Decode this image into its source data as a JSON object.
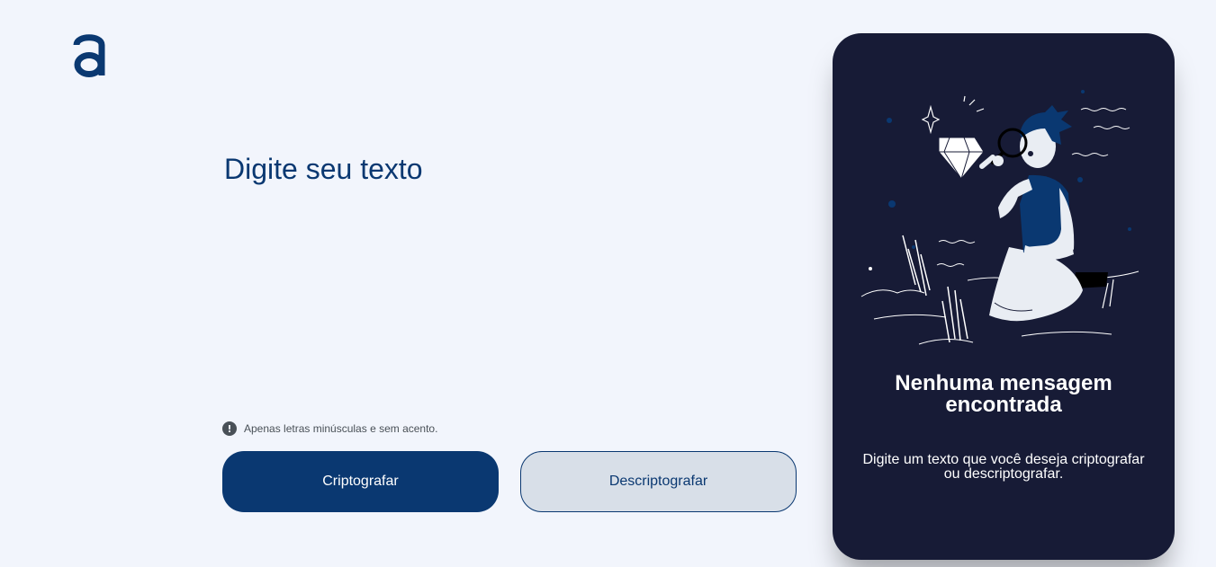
{
  "brand": {
    "logo_icon": "alura-a-logo-icon",
    "accent_color": "#0a3871"
  },
  "input": {
    "placeholder": "Digite seu texto",
    "value": ""
  },
  "hint": {
    "icon": "exclamation-circle-icon",
    "text": "Apenas letras minúsculas e sem acento."
  },
  "actions": {
    "encrypt_label": "Criptografar",
    "decrypt_label": "Descriptografar"
  },
  "output_panel": {
    "background_color": "#171b36",
    "illustration": "person-with-magnifying-glass-and-diamond-illustration",
    "title": "Nenhuma mensagem encontrada",
    "description": "Digite um texto que você deseja criptografar ou descriptografar."
  }
}
